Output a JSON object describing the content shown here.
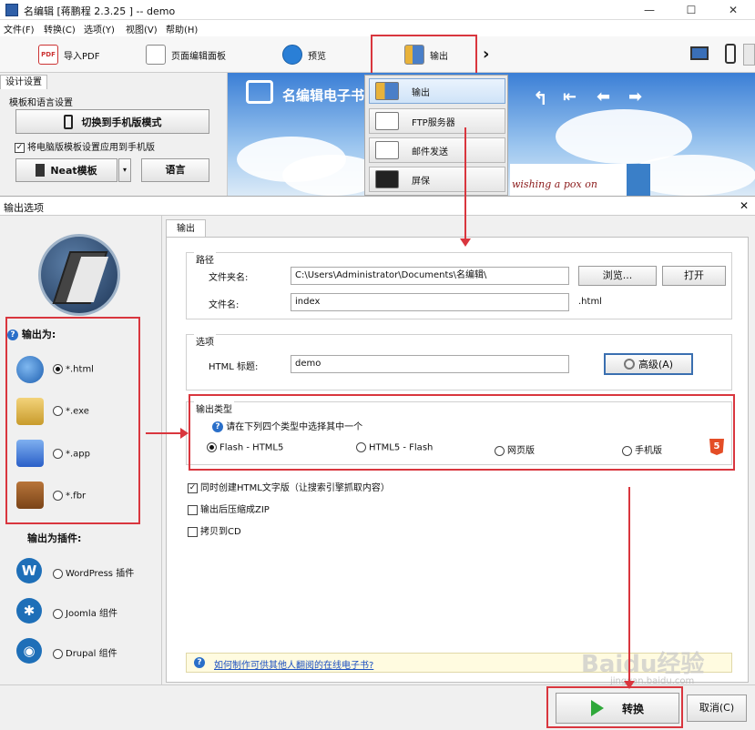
{
  "window": {
    "title": "名编辑 [蒋鹏程 2.3.25 ] -- demo",
    "min": "—",
    "max": "☐",
    "close": "✕"
  },
  "menu": [
    "文件(F)",
    "转换(C)",
    "选项(Y)",
    "视图(V)",
    "帮助(H)"
  ],
  "toolbar": {
    "import_pdf": "导入PDF",
    "page_editor": "页面编辑面板",
    "preview": "预览",
    "output": "输出",
    "more": "›",
    "pdf_badge": "PDF"
  },
  "design": {
    "tab": "设计设置",
    "section": "模板和语言设置",
    "switch_mobile": "切换到手机版模式",
    "apply_checkbox": "将电脑版模板设置应用到手机版",
    "neat_template": "Neat模板",
    "language": "语言"
  },
  "preview": {
    "logo_text": "名编辑电子书",
    "tagline": "wishing a pox on"
  },
  "dropdown": [
    "输出",
    "FTP服务器",
    "邮件发送",
    "屏保"
  ],
  "dialog": {
    "title": "输出选项",
    "close": "✕"
  },
  "side": {
    "output_as_label": "输出为:",
    "formats": [
      "*.html",
      "*.exe",
      "*.app",
      "*.fbr"
    ],
    "selected_format": "*.html",
    "plugins_label": "输出为插件:",
    "plugins": [
      "WordPress 插件",
      "Joomla 组件",
      "Drupal 组件"
    ]
  },
  "tab": "输出",
  "path": {
    "legend": "路径",
    "folder_label": "文件夹名:",
    "folder_value": "C:\\Users\\Administrator\\Documents\\名编辑\\",
    "browse": "浏览...",
    "open": "打开",
    "filename_label": "文件名:",
    "filename_value": "index",
    "ext": ".html"
  },
  "options": {
    "legend": "选项",
    "html_title_label": "HTML 标题:",
    "html_title_value": "demo",
    "advanced": "高级(A)"
  },
  "output_type": {
    "legend": "输出类型",
    "hint": "请在下列四个类型中选择其中一个",
    "types": [
      "Flash - HTML5",
      "HTML5 - Flash",
      "网页版",
      "手机版"
    ],
    "selected": "Flash - HTML5",
    "html5_badge": "5"
  },
  "checks": [
    {
      "label": "同时创建HTML文字版（让搜索引擎抓取内容）",
      "checked": true
    },
    {
      "label": "输出后压缩成ZIP",
      "checked": false
    },
    {
      "label": "拷贝到CD",
      "checked": false
    }
  ],
  "help_link": "如何制作可供其他人翻阅的在线电子书?",
  "footer": {
    "convert": "转换",
    "cancel": "取消(C)"
  },
  "watermark": {
    "brand": "Baidu经验",
    "url": "jingyan.baidu.com"
  },
  "colors": {
    "highlight": "#d9363e",
    "link": "#1a4fc0"
  }
}
